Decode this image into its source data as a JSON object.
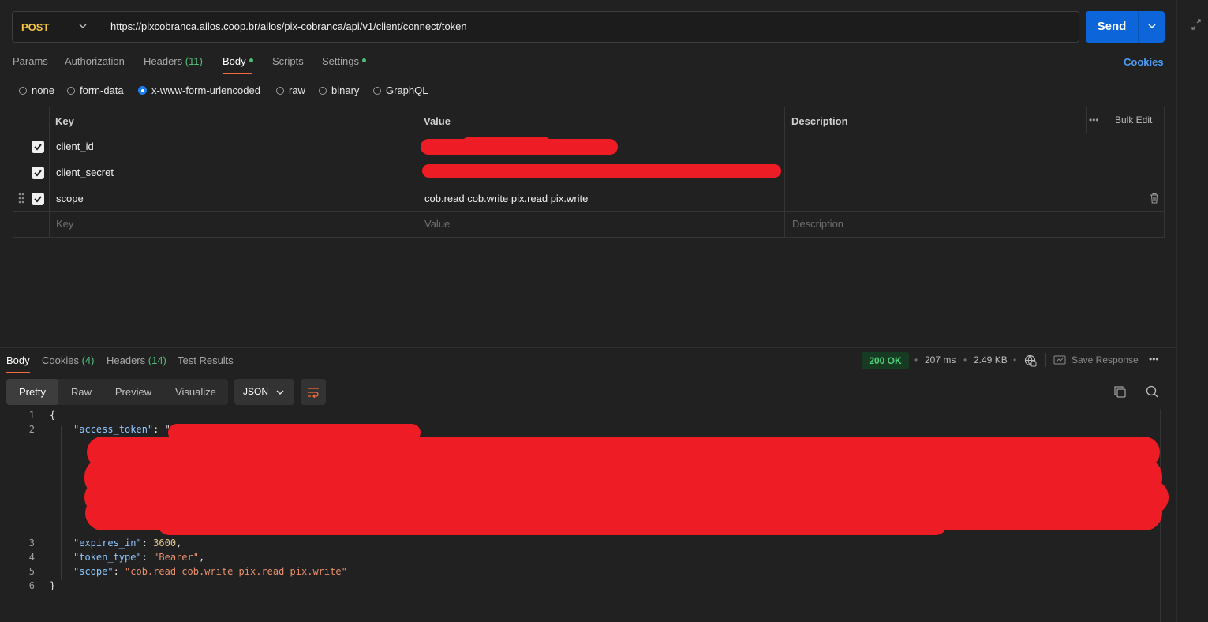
{
  "request": {
    "method": "POST",
    "url": "https://pixcobranca.ailos.coop.br/ailos/pix-cobranca/api/v1/client/connect/token",
    "send_label": "Send"
  },
  "request_tabs": {
    "params": "Params",
    "authorization": "Authorization",
    "headers_label": "Headers",
    "headers_count": "(11)",
    "body": "Body",
    "scripts": "Scripts",
    "settings": "Settings",
    "cookies": "Cookies"
  },
  "body_types": [
    "none",
    "form-data",
    "x-www-form-urlencoded",
    "raw",
    "binary",
    "GraphQL"
  ],
  "body_type_selected": "x-www-form-urlencoded",
  "table": {
    "headers": {
      "key": "Key",
      "value": "Value",
      "description": "Description",
      "bulk_edit": "Bulk Edit"
    },
    "rows": [
      {
        "key": "client_id",
        "value": "",
        "checked": true,
        "redacted": true
      },
      {
        "key": "client_secret",
        "value": "",
        "checked": true,
        "redacted": true
      },
      {
        "key": "scope",
        "value": "cob.read cob.write pix.read pix.write",
        "checked": true,
        "redacted": false
      }
    ],
    "placeholders": {
      "key": "Key",
      "value": "Value",
      "description": "Description"
    }
  },
  "response_tabs": {
    "body": "Body",
    "cookies_label": "Cookies",
    "cookies_count": "(4)",
    "headers_label": "Headers",
    "headers_count": "(14)",
    "test_results": "Test Results"
  },
  "response_meta": {
    "status": "200 OK",
    "time": "207 ms",
    "size": "2.49 KB",
    "save_response": "Save Response"
  },
  "view_modes": [
    "Pretty",
    "Raw",
    "Preview",
    "Visualize"
  ],
  "view_selected": "Pretty",
  "format": "JSON",
  "response_body": {
    "line_numbers": [
      "1",
      "2",
      "3",
      "4",
      "5",
      "6"
    ],
    "open_brace": "{",
    "close_brace": "}",
    "access_token_key": "\"access_token\"",
    "access_token_prefix": ": \"",
    "expires_in_key": "\"expires_in\"",
    "expires_in_value": "3600",
    "token_type_key": "\"token_type\"",
    "token_type_value": "\"Bearer\"",
    "scope_key": "\"scope\"",
    "scope_value": "\"cob.read cob.write pix.read pix.write\""
  },
  "colors": {
    "accent_orange": "#f26b3a",
    "send_blue": "#0c66d9",
    "method_yellow": "#f5c542",
    "success_green": "#4fd17b",
    "redaction_red": "#ee1c25"
  }
}
